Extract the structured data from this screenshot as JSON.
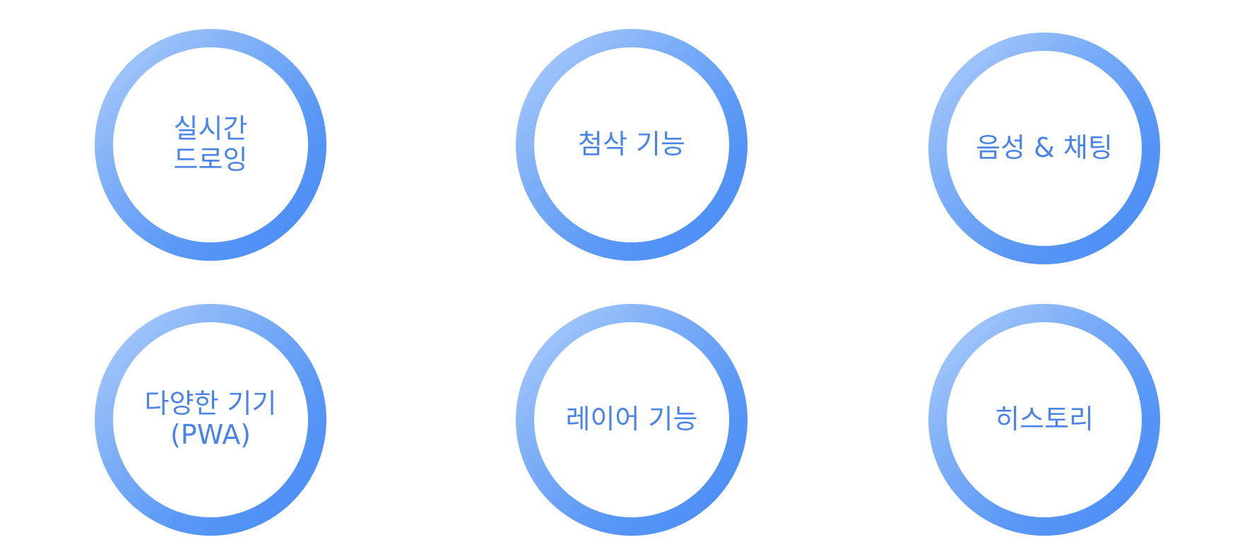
{
  "features": [
    {
      "label": "실시간\n드로잉"
    },
    {
      "label": "첨삭 기능"
    },
    {
      "label": "음성 & 채팅"
    },
    {
      "label": "다양한 기기\n(PWA)"
    },
    {
      "label": "레이어 기능"
    },
    {
      "label": "히스토리"
    }
  ],
  "colors": {
    "text": "#4a84e8",
    "ring_light": "#b3d0fa",
    "ring_dark": "#468af5",
    "background": "#ffffff"
  }
}
